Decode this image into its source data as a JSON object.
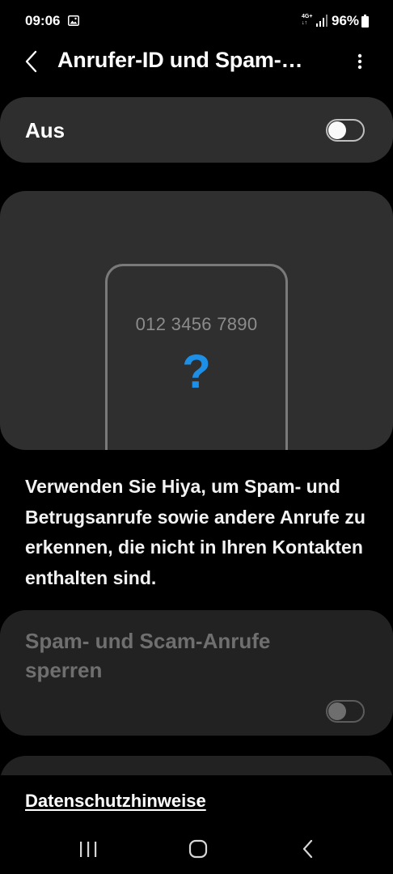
{
  "status_bar": {
    "time": "09:06",
    "network_line1": "4G+",
    "network_line2": "↓↑",
    "battery": "96%"
  },
  "header": {
    "title": "Anrufer-ID und Spam-…",
    "back_icon": "chevron-left-icon",
    "menu_icon": "more-vertical-icon"
  },
  "master_switch": {
    "label": "Aus",
    "state": "off"
  },
  "illustration": {
    "phone_number": "012 3456 7890",
    "symbol": "?",
    "accent_color": "#1e8fe6"
  },
  "description": "Verwenden Sie Hiya, um Spam- und Betrugsanrufe sowie andere Anrufe zu erkennen, die nicht in Ihren Kontakten enthalten sind.",
  "spam_block": {
    "label": "Spam- und Scam-Anrufe sperren",
    "state": "off",
    "enabled": false
  },
  "footer": {
    "privacy_link": "Datenschutzhinweise"
  },
  "nav_bar": {
    "recents_icon": "recents-icon",
    "home_icon": "home-icon",
    "back_icon": "back-icon"
  }
}
